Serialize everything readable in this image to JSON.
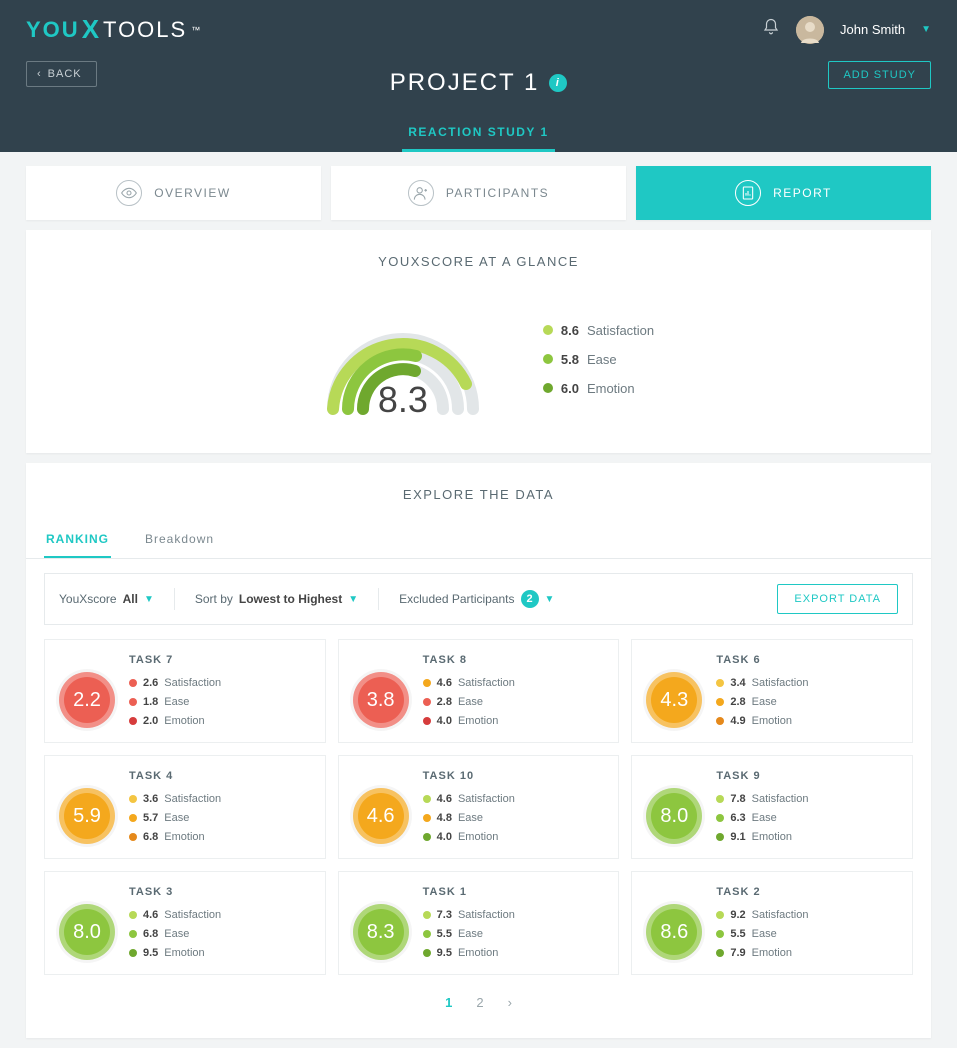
{
  "header": {
    "logo_you": "YOU",
    "logo_tools": "TOOLS",
    "logo_tm": "™",
    "username": "John Smith",
    "back_label": "BACK",
    "add_study_label": "ADD STUDY",
    "project_title": "PROJECT 1",
    "study_tab": "REACTION STUDY 1"
  },
  "section_tabs": {
    "overview": "OVERVIEW",
    "participants": "PARTICIPANTS",
    "report": "REPORT"
  },
  "glance": {
    "title": "YOUXSCORE AT A GLANCE",
    "score": "8.3",
    "legend": [
      {
        "value": "8.6",
        "label": "Satisfaction",
        "color": "#b7d957"
      },
      {
        "value": "5.8",
        "label": "Ease",
        "color": "#8dc63f"
      },
      {
        "value": "6.0",
        "label": "Emotion",
        "color": "#6fa82e"
      }
    ]
  },
  "explore": {
    "title": "EXPLORE THE DATA",
    "subtabs": {
      "ranking": "RANKING",
      "breakdown": "Breakdown"
    },
    "filter_youx_label": "YouXscore",
    "filter_youx_value": "All",
    "sort_label": "Sort by",
    "sort_value": "Lowest to Highest",
    "excluded_label": "Excluded Participants",
    "excluded_count": "2",
    "export_label": "EXPORT DATA"
  },
  "metric_labels": {
    "sat": "Satisfaction",
    "ease": "Ease",
    "emo": "Emotion"
  },
  "tasks": [
    {
      "title": "TASK 7",
      "score": "2.2",
      "cls": "red",
      "sat": "2.6",
      "sat_c": "#ec5f53",
      "ease": "1.8",
      "ease_c": "#ec5f53",
      "emo": "2.0",
      "emo_c": "#d63c3c"
    },
    {
      "title": "TASK 8",
      "score": "3.8",
      "cls": "red",
      "sat": "4.6",
      "sat_c": "#f4a81d",
      "ease": "2.8",
      "ease_c": "#ec5f53",
      "emo": "4.0",
      "emo_c": "#d63c3c"
    },
    {
      "title": "TASK 6",
      "score": "4.3",
      "cls": "orange",
      "sat": "3.4",
      "sat_c": "#f4c542",
      "ease": "2.8",
      "ease_c": "#f4a81d",
      "emo": "4.9",
      "emo_c": "#e5891b"
    },
    {
      "title": "TASK 4",
      "score": "5.9",
      "cls": "orange",
      "sat": "3.6",
      "sat_c": "#f4c542",
      "ease": "5.7",
      "ease_c": "#f4a81d",
      "emo": "6.8",
      "emo_c": "#e5891b"
    },
    {
      "title": "TASK 10",
      "score": "4.6",
      "cls": "orange",
      "sat": "4.6",
      "sat_c": "#b7d957",
      "ease": "4.8",
      "ease_c": "#f4a81d",
      "emo": "4.0",
      "emo_c": "#6fa82e"
    },
    {
      "title": "TASK 9",
      "score": "8.0",
      "cls": "green",
      "sat": "7.8",
      "sat_c": "#b7d957",
      "ease": "6.3",
      "ease_c": "#8dc63f",
      "emo": "9.1",
      "emo_c": "#6fa82e"
    },
    {
      "title": "TASK 3",
      "score": "8.0",
      "cls": "green",
      "sat": "4.6",
      "sat_c": "#b7d957",
      "ease": "6.8",
      "ease_c": "#8dc63f",
      "emo": "9.5",
      "emo_c": "#6fa82e"
    },
    {
      "title": "TASK 1",
      "score": "8.3",
      "cls": "green",
      "sat": "7.3",
      "sat_c": "#b7d957",
      "ease": "5.5",
      "ease_c": "#8dc63f",
      "emo": "9.5",
      "emo_c": "#6fa82e"
    },
    {
      "title": "TASK 2",
      "score": "8.6",
      "cls": "green",
      "sat": "9.2",
      "sat_c": "#b7d957",
      "ease": "5.5",
      "ease_c": "#8dc63f",
      "emo": "7.9",
      "emo_c": "#6fa82e"
    }
  ],
  "pager": {
    "p1": "1",
    "p2": "2"
  },
  "chart_data": {
    "type": "gauge_multi",
    "title": "YouXscore at a glance",
    "center_value": 8.3,
    "scale": [
      0,
      10
    ],
    "series": [
      {
        "name": "Satisfaction",
        "value": 8.6,
        "color": "#b7d957"
      },
      {
        "name": "Ease",
        "value": 5.8,
        "color": "#8dc63f"
      },
      {
        "name": "Emotion",
        "value": 6.0,
        "color": "#6fa82e"
      }
    ]
  }
}
